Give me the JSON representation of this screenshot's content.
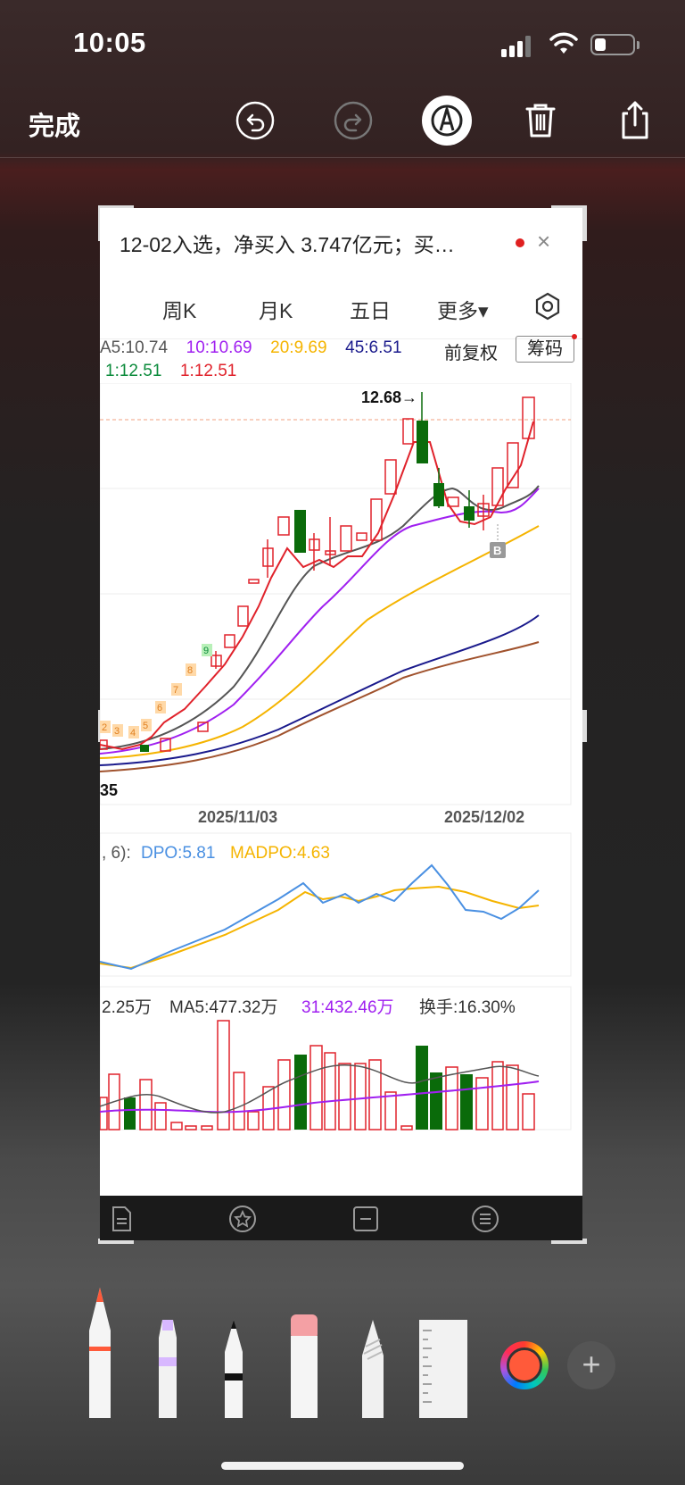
{
  "status": {
    "time": "10:05"
  },
  "toolbar": {
    "done_label": "完成",
    "icons": [
      "undo-icon",
      "redo-icon",
      "markup-pen-icon",
      "trash-icon",
      "share-icon"
    ]
  },
  "screenshot": {
    "banner": {
      "text": "12-02入选，净买入 3.747亿元；买…",
      "close": "×"
    },
    "tabs": [
      "周K",
      "月K",
      "五日",
      "更多▾"
    ],
    "ma_line1": {
      "ma5": "A5:10.74",
      "ma10": "10:10.69",
      "ma20": "20:9.69",
      "ma45": "45:6.51"
    },
    "ma_line2": {
      "a": "1:12.51",
      "b": "1:12.51"
    },
    "fq_label": "前复权",
    "chip_label": "筹码",
    "price_high": "12.68→",
    "price_low": "35",
    "signal_b": "B",
    "dates": [
      "2025/11/03",
      "2025/12/02"
    ],
    "td_counts": [
      "2",
      "3",
      "4",
      "5",
      "6",
      "7",
      "8",
      "9"
    ],
    "dpo": {
      "prefix": ", 6):",
      "dpo": "DPO:5.81",
      "madpo": "MADPO:4.63"
    },
    "volume": {
      "vol": "2.25万",
      "ma5": "MA5:477.32万",
      "ma31": "31:432.46万",
      "turnover": "换手:16.30%"
    },
    "bottom_icons": [
      "document-icon",
      "favorite-icon",
      "minus-box-icon",
      "menu-icon"
    ]
  },
  "colors": {
    "up": "#e0222b",
    "down": "#0a6b0a",
    "ma5": "#555555",
    "ma10": "#a020f0",
    "ma20": "#f5b400",
    "ma45": "#1a1a8c",
    "ma60": "#a0522d",
    "dpo": "#4a90e2",
    "madpo": "#f5b400"
  }
}
